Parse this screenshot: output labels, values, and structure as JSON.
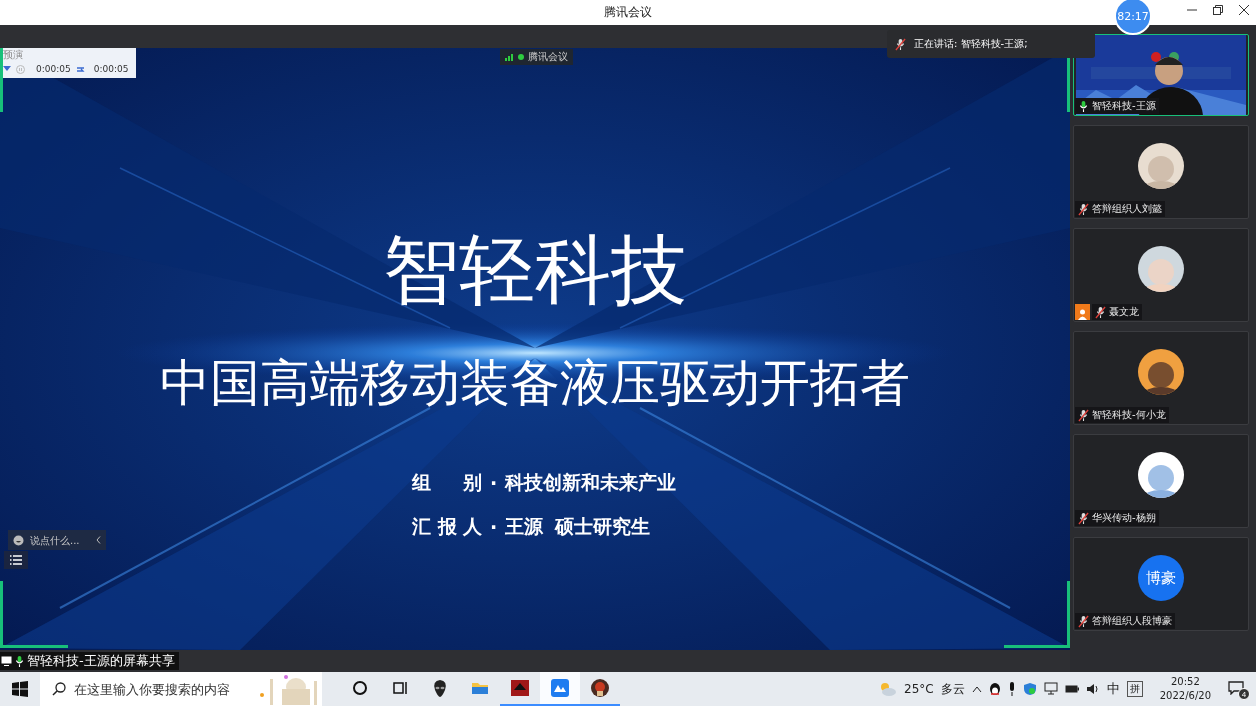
{
  "window": {
    "title": "腾讯会议",
    "timer": "82:17"
  },
  "speaking": {
    "label": "正在讲话: 智轻科技-王源;",
    "muted": true
  },
  "preview_widget": {
    "title": "预演",
    "elapsed": "0:00:05",
    "total": "0:00:05"
  },
  "meeting_badge": {
    "label": "腾讯会议"
  },
  "slide": {
    "title": "智轻科技",
    "subtitle": "中国高端移动装备液压驱动开拓者",
    "info": [
      {
        "label": [
          "组",
          "别"
        ],
        "sep": "·",
        "words": [
          "科技创新和未来产业"
        ]
      },
      {
        "label": [
          "汇",
          "报",
          "人"
        ],
        "sep": "·",
        "words": [
          "王源",
          "硕士研究生"
        ]
      }
    ]
  },
  "chat": {
    "placeholder": "说点什么..."
  },
  "share_label": "智轻科技-王源的屏幕共享",
  "participants": [
    {
      "name": "智轻科技-王源",
      "muted": false,
      "avatar": {
        "kind": "video"
      }
    },
    {
      "name": "答辩组织人刘懿",
      "muted": true
    },
    {
      "name": "聂文龙",
      "muted": true,
      "host": true
    },
    {
      "name": "智轻科技-何小龙",
      "muted": true
    },
    {
      "name": "华兴传动-杨朔",
      "muted": true
    },
    {
      "name": "答辩组织人段博豪",
      "muted": true,
      "avatar": {
        "kind": "initials",
        "text": "博豪"
      }
    }
  ],
  "taskbar": {
    "search_placeholder": "在这里输入你要搜索的内容",
    "apps": [
      {
        "kind": "cortana",
        "open": false,
        "selected": false
      },
      {
        "kind": "taskview",
        "open": false,
        "selected": false
      },
      {
        "kind": "alien",
        "open": false,
        "selected": false
      },
      {
        "kind": "folder",
        "open": false,
        "selected": false
      },
      {
        "kind": "redapp",
        "open": true,
        "selected": false
      },
      {
        "kind": "meeting",
        "open": true,
        "selected": true
      },
      {
        "kind": "game",
        "open": true,
        "selected": false
      }
    ],
    "weather": {
      "temp": "25°C",
      "condition": "多云"
    },
    "ime": "中",
    "ime_mode": "拼",
    "time": "20:52",
    "date": "2022/6/20",
    "notifications": "4"
  }
}
